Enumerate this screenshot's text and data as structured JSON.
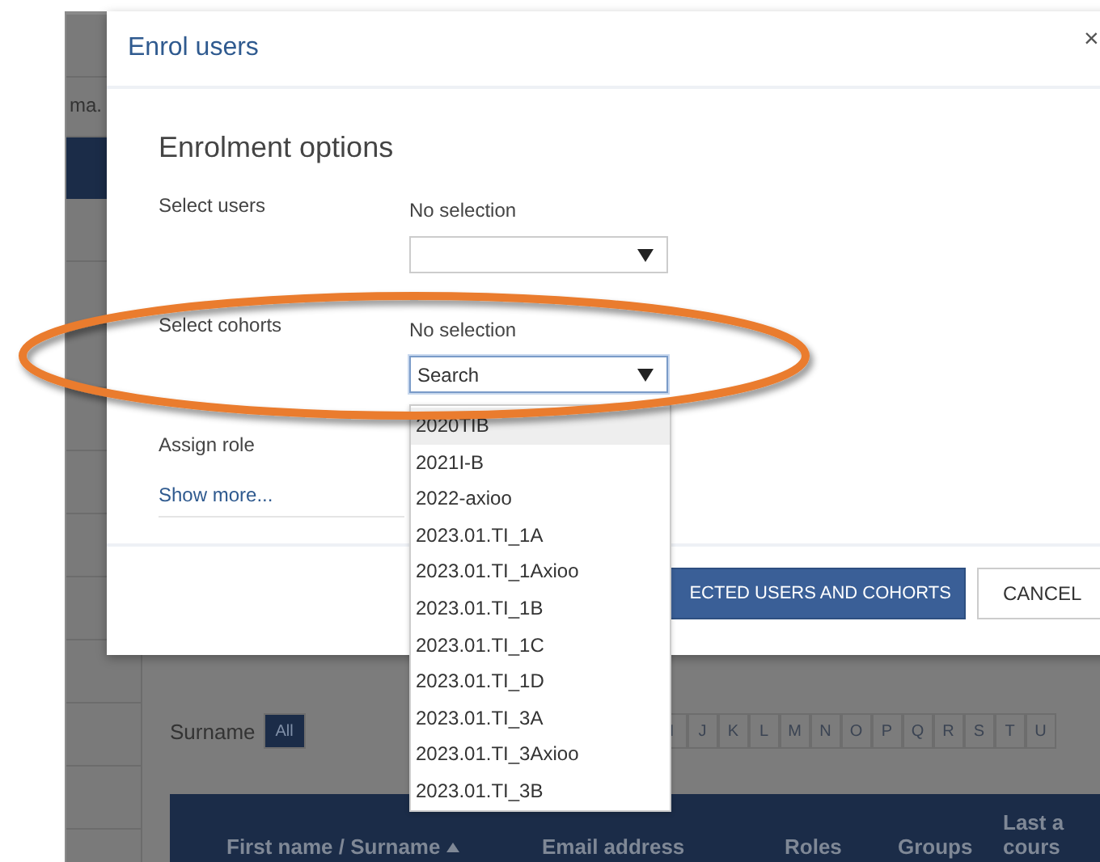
{
  "background": {
    "sidebar_text": "ma.",
    "surname_filter": {
      "label": "Surname",
      "letters": [
        {
          "label": "All",
          "selected": true
        },
        {
          "label": "I",
          "selected": false
        },
        {
          "label": "J",
          "selected": false
        },
        {
          "label": "K",
          "selected": false
        },
        {
          "label": "L",
          "selected": false
        },
        {
          "label": "M",
          "selected": false
        },
        {
          "label": "N",
          "selected": false
        },
        {
          "label": "O",
          "selected": false
        },
        {
          "label": "P",
          "selected": false
        },
        {
          "label": "Q",
          "selected": false
        },
        {
          "label": "R",
          "selected": false
        },
        {
          "label": "S",
          "selected": false
        },
        {
          "label": "T",
          "selected": false
        },
        {
          "label": "U",
          "selected": false
        }
      ]
    },
    "table": {
      "columns": [
        "First name / Surname",
        "Email address",
        "Roles",
        "Groups",
        "Last a\ncours"
      ]
    }
  },
  "dialog": {
    "title": "Enrol users",
    "close": "×",
    "heading": "Enrolment options",
    "rows": [
      {
        "kind": "value",
        "label": "Select users",
        "value": "No selection"
      },
      {
        "kind": "field",
        "label": "",
        "placeholder": "",
        "open": false
      },
      {
        "kind": "value",
        "label": "Select cohorts",
        "value": "No selection"
      },
      {
        "kind": "field",
        "label": "",
        "placeholder": "Search",
        "open": true
      },
      {
        "kind": "value",
        "label": "Assign role",
        "value": ""
      }
    ],
    "show_more": "Show more...",
    "options": [
      {
        "label": "2020TIB",
        "selected": true
      },
      {
        "label": "2021I-B",
        "selected": false
      },
      {
        "label": "2022-axioo",
        "selected": false
      },
      {
        "label": "2023.01.TI_1A",
        "selected": false
      },
      {
        "label": "2023.01.TI_1Axioo",
        "selected": false
      },
      {
        "label": "2023.01.TI_1B",
        "selected": false
      },
      {
        "label": "2023.01.TI_1C",
        "selected": false
      },
      {
        "label": "2023.01.TI_1D",
        "selected": false
      },
      {
        "label": "2023.01.TI_3A",
        "selected": false
      },
      {
        "label": "2023.01.TI_3Axioo",
        "selected": false
      },
      {
        "label": "2023.01.TI_3B",
        "selected": false
      }
    ],
    "buttons": [
      {
        "kind": "primary",
        "label": "ECTED USERS AND COHORTS"
      },
      {
        "kind": "secondary",
        "label": "CANCEL"
      }
    ]
  }
}
